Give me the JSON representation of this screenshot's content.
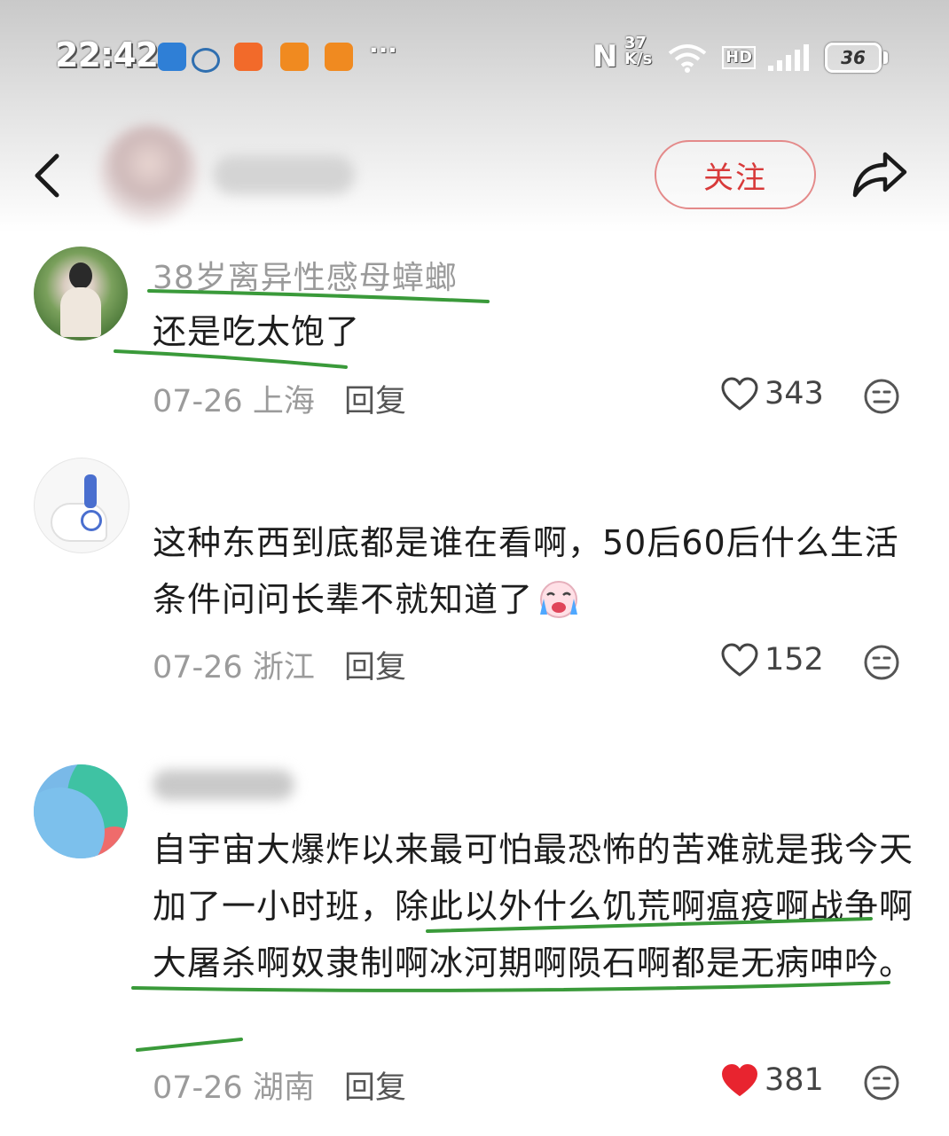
{
  "status_bar": {
    "time": "22:42",
    "net_speed_top": "37",
    "net_speed_unit": "K/s",
    "signal_label": "HD",
    "battery": "36",
    "more": "···"
  },
  "header": {
    "follow_label": "关注"
  },
  "comments": [
    {
      "username": "38岁离异性感母蟑螂",
      "text": "还是吃太饱了",
      "date": "07-26",
      "location": "上海",
      "reply_label": "回复",
      "likes": "343",
      "liked": false
    },
    {
      "username": "",
      "text": "这种东西到底都是谁在看啊，50后60后什么生活条件问问长辈不就知道了",
      "date": "07-26",
      "location": "浙江",
      "reply_label": "回复",
      "likes": "152",
      "liked": false
    },
    {
      "username": "",
      "text": "自宇宙大爆炸以来最可怕最恐怖的苦难就是我今天加了一小时班，除此以外什么饥荒啊瘟疫啊战争啊大屠杀啊奴隶制啊冰河期啊陨石啊都是无病呻吟。",
      "date": "07-26",
      "location": "湖南",
      "reply_label": "回复",
      "likes": "381",
      "liked": true
    }
  ],
  "colors": {
    "follow_accent": "#d83a3a",
    "liked_heart": "#e8242f",
    "underline_green": "#3a9a3a"
  }
}
